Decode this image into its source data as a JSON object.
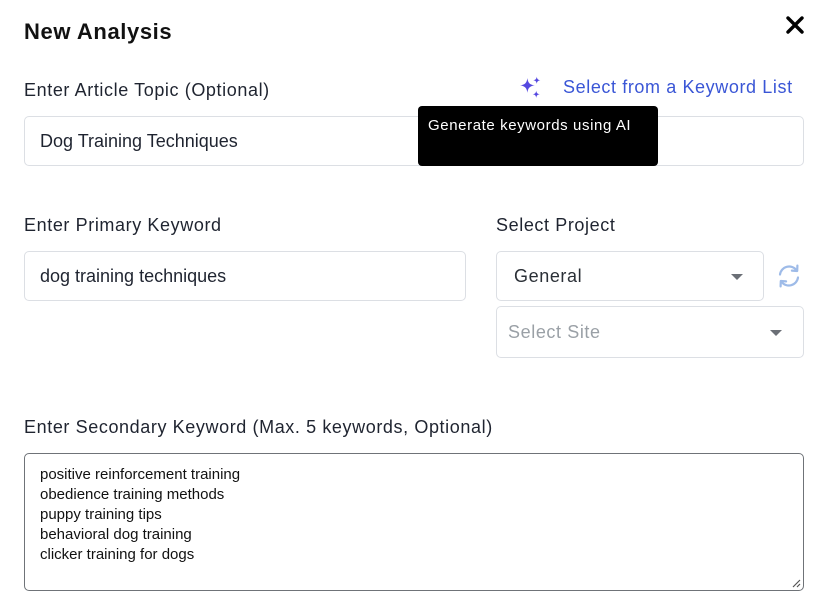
{
  "dialog": {
    "title": "New Analysis",
    "close_icon": "close-icon"
  },
  "article_topic": {
    "label": "Enter Article Topic (Optional)",
    "value": "Dog Training Techniques",
    "keyword_list_link": "Select from a Keyword List",
    "ai_icon": "sparkles-icon",
    "tooltip": "Generate keywords using AI"
  },
  "primary_keyword": {
    "label": "Enter Primary Keyword",
    "value": "dog training techniques"
  },
  "project": {
    "label": "Select Project",
    "selected": "General",
    "site_placeholder": "Select Site",
    "refresh_icon": "refresh-icon"
  },
  "secondary_keywords": {
    "label": "Enter Secondary Keyword (Max. 5 keywords, Optional)",
    "items": [
      "positive reinforcement training",
      "obedience training methods",
      "puppy training tips",
      "behavioral dog training",
      "clicker training for dogs"
    ]
  },
  "colors": {
    "accent": "#3a56d6",
    "sparkle": "#5548e0",
    "refresh": "#9ebbe8",
    "tooltip_bg": "#000000"
  }
}
